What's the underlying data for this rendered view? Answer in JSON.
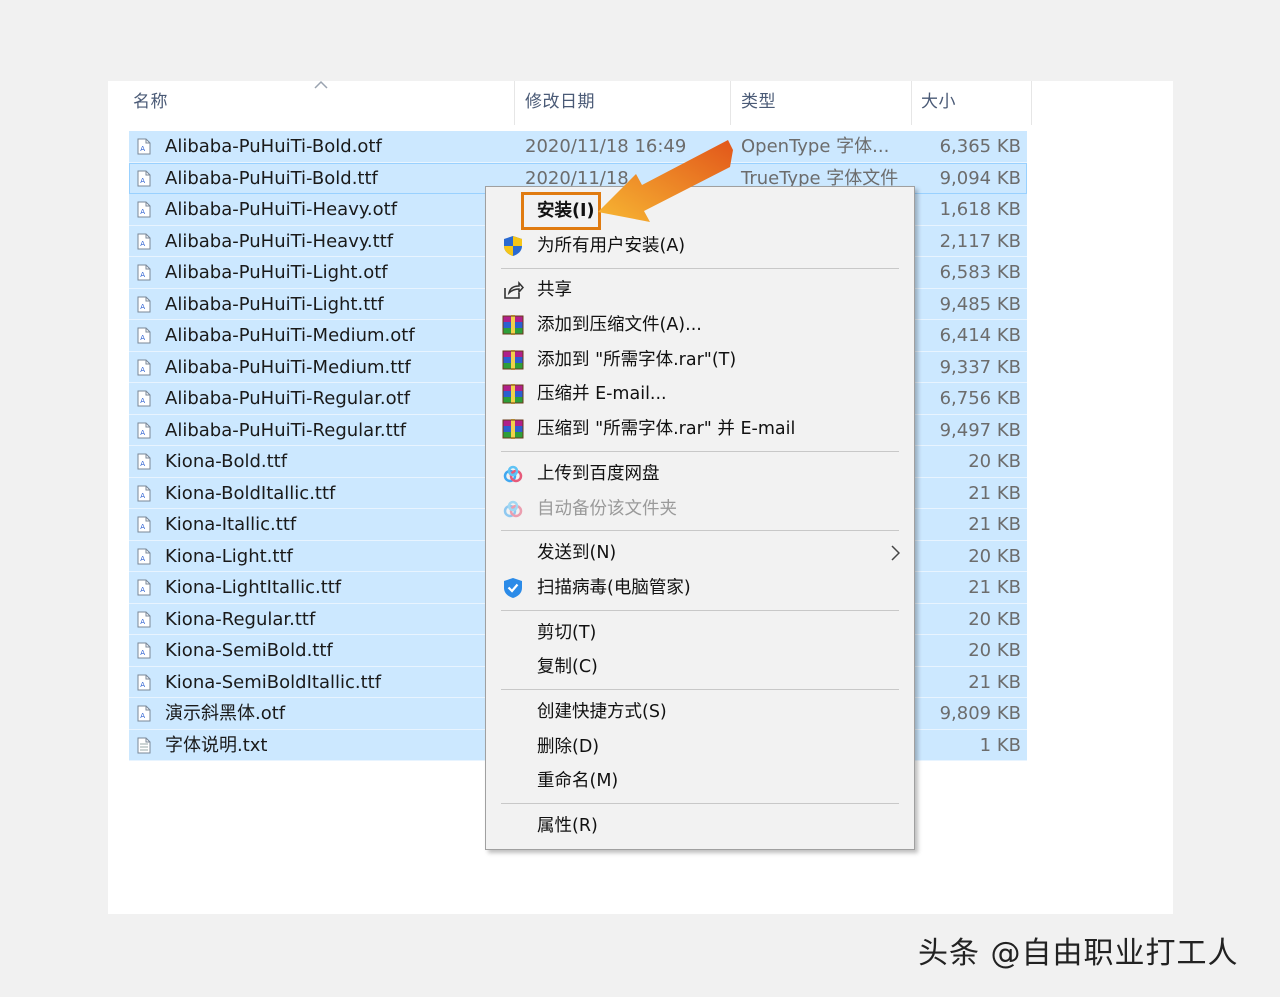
{
  "columns": {
    "name": "名称",
    "modified": "修改日期",
    "type": "类型",
    "size": "大小"
  },
  "files": [
    {
      "name": "Alibaba-PuHuiTi-Bold.otf",
      "date": "2020/11/18 16:49",
      "type": "OpenType 字体...",
      "size": "6,365 KB"
    },
    {
      "name": "Alibaba-PuHuiTi-Bold.ttf",
      "date": "2020/11/18",
      "type": "TrueType 字体文件",
      "size": "9,094 KB"
    },
    {
      "name": "Alibaba-PuHuiTi-Heavy.otf",
      "date": "",
      "type": "",
      "size": "1,618 KB"
    },
    {
      "name": "Alibaba-PuHuiTi-Heavy.ttf",
      "date": "",
      "type": "",
      "size": "2,117 KB"
    },
    {
      "name": "Alibaba-PuHuiTi-Light.otf",
      "date": "",
      "type": "",
      "size": "6,583 KB"
    },
    {
      "name": "Alibaba-PuHuiTi-Light.ttf",
      "date": "",
      "type": "",
      "size": "9,485 KB"
    },
    {
      "name": "Alibaba-PuHuiTi-Medium.otf",
      "date": "",
      "type": "",
      "size": "6,414 KB"
    },
    {
      "name": "Alibaba-PuHuiTi-Medium.ttf",
      "date": "",
      "type": "",
      "size": "9,337 KB"
    },
    {
      "name": "Alibaba-PuHuiTi-Regular.otf",
      "date": "",
      "type": "",
      "size": "6,756 KB"
    },
    {
      "name": "Alibaba-PuHuiTi-Regular.ttf",
      "date": "",
      "type": "",
      "size": "9,497 KB"
    },
    {
      "name": "Kiona-Bold.ttf",
      "date": "",
      "type": "",
      "size": "20 KB"
    },
    {
      "name": "Kiona-BoldItallic.ttf",
      "date": "",
      "type": "",
      "size": "21 KB"
    },
    {
      "name": "Kiona-Itallic.ttf",
      "date": "",
      "type": "",
      "size": "21 KB"
    },
    {
      "name": "Kiona-Light.ttf",
      "date": "",
      "type": "",
      "size": "20 KB"
    },
    {
      "name": "Kiona-LightItallic.ttf",
      "date": "",
      "type": "",
      "size": "21 KB"
    },
    {
      "name": "Kiona-Regular.ttf",
      "date": "",
      "type": "",
      "size": "20 KB"
    },
    {
      "name": "Kiona-SemiBold.ttf",
      "date": "",
      "type": "",
      "size": "20 KB"
    },
    {
      "name": "Kiona-SemiBoldItallic.ttf",
      "date": "",
      "type": "",
      "size": "21 KB"
    },
    {
      "name": "演示斜黑体.otf",
      "date": "",
      "type": "",
      "size": "9,809 KB"
    },
    {
      "name": "字体说明.txt",
      "date": "",
      "type": "",
      "size": "1 KB",
      "icon": "text-file-icon"
    }
  ],
  "context_menu": {
    "install": "安装(I)",
    "install_all_users": "为所有用户安装(A)",
    "share": "共享",
    "add_to_archive": "添加到压缩文件(A)...",
    "add_to_named_rar": "添加到 \"所需字体.rar\"(T)",
    "compress_email": "压缩并 E-mail...",
    "compress_named_email": "压缩到 \"所需字体.rar\" 并 E-mail",
    "upload_baidu": "上传到百度网盘",
    "auto_backup": "自动备份该文件夹",
    "send_to": "发送到(N)",
    "scan_virus": "扫描病毒(电脑管家)",
    "cut": "剪切(T)",
    "copy": "复制(C)",
    "create_shortcut": "创建快捷方式(S)",
    "delete": "删除(D)",
    "rename": "重命名(M)",
    "properties": "属性(R)"
  },
  "watermark": "头条 @自由职业打工人",
  "colors": {
    "selection": "#cce8ff",
    "highlight": "#e07b10",
    "arrow": "#f29a1c"
  }
}
